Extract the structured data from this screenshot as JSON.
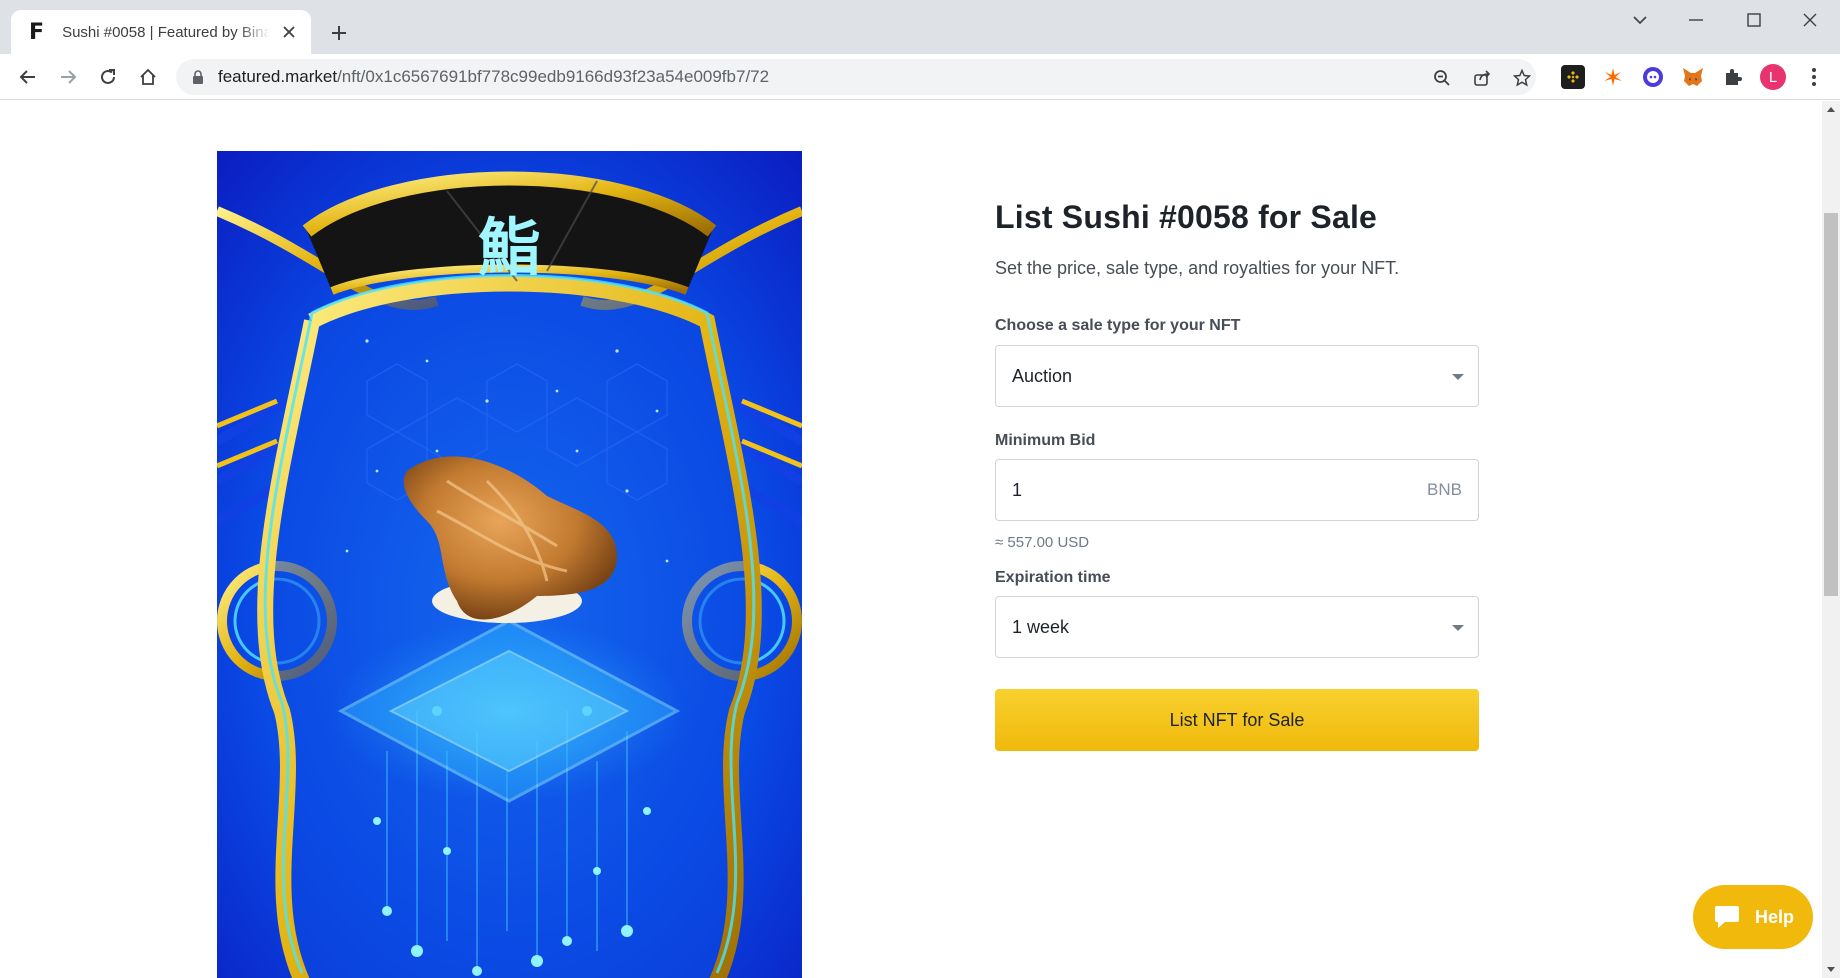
{
  "browser": {
    "tab_title": "Sushi #0058 | Featured by Binance",
    "url_domain": "featured.market",
    "url_path": "/nft/0x1c6567691bf778c99edb9166d93f23a54e009fb7/72",
    "profile_initial": "L"
  },
  "nft": {
    "kanji": "鮨"
  },
  "form": {
    "title": "List Sushi #0058 for Sale",
    "subtitle": "Set the price, sale type, and royalties for your NFT.",
    "sale_type_label": "Choose a sale type for your NFT",
    "sale_type_value": "Auction",
    "min_bid_label": "Minimum Bid",
    "min_bid_value": "1",
    "min_bid_unit": "BNB",
    "usd_estimate": "≈ 557.00 USD",
    "expiration_label": "Expiration time",
    "expiration_value": "1 week",
    "submit_label": "List NFT for Sale"
  },
  "help_widget": {
    "label": "Help"
  },
  "colors": {
    "accent": "#f0b90b",
    "text_primary": "#1e2329"
  }
}
